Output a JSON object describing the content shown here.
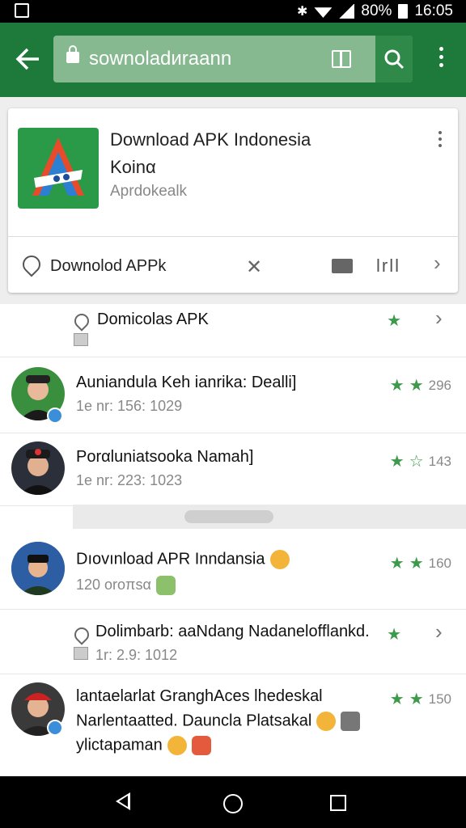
{
  "status_bar": {
    "battery": "80%",
    "time": "16:05"
  },
  "app_bar": {
    "url_text": "sownoladиrаann"
  },
  "app_card": {
    "title": "Download APK Indonesia",
    "subtitle": "Koinα",
    "developer": "Aprdokealk",
    "bottom_label": "Downolod APPk",
    "bars_label": "lrll"
  },
  "list": {
    "row1": {
      "title": "Domicolas APK"
    },
    "row2": {
      "title": "Auniandula Keh ianrika: Dealli]",
      "meta": "1e nr: 156: 1029",
      "rating_count": "296"
    },
    "row3": {
      "title": "Porαluniatsooka Namah]",
      "meta": "1e nr: 223: 1023",
      "rating_count": "143"
    },
    "row4": {
      "title": "Dıovınload APR Inndansia",
      "meta": "120 oroπsα",
      "rating_count": "160"
    },
    "row5": {
      "title": "Dolimbarb: aaNdang Nadanelofflankd.",
      "meta": "1r: 2.9: 1012"
    },
    "row6": {
      "title_line1": "lantaelarlat GranghAces lhedeskal",
      "title_line2": "Narlentaatted. Dauncla Platsakal",
      "title_line3": "ylictapaman",
      "rating_count": "150"
    }
  },
  "colors": {
    "app_bar": "#1e7a3a",
    "url_bar": "#86b98f",
    "star": "#3c9a4a"
  }
}
